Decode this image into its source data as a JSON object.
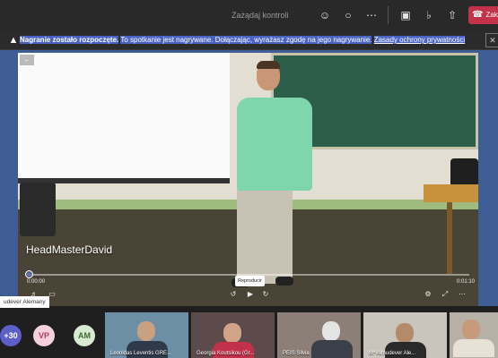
{
  "topbar": {
    "request_control": "Zażądaj kontroli",
    "icons": [
      "people-icon",
      "react-icon",
      "more-icon",
      "camera-icon",
      "microphone-icon",
      "share-tray-icon"
    ],
    "leave_label": "Zak"
  },
  "banner": {
    "bold": "Nagranie zostało rozpoczęte.",
    "text": "To spotkanie jest nagrywane. Dołączając, wyrażasz zgodę na jego nagrywanie.",
    "link": "Zasady ochrony prywatności"
  },
  "video": {
    "presenter_name": "HeadMasterDavid",
    "time_elapsed": "0:00:00",
    "time_total": "0:01:10",
    "progress": 0.0,
    "tooltip": "Reproducir"
  },
  "name_chip": "udever Alemany",
  "strip": {
    "avatars": [
      {
        "label": "+30",
        "color": "#5b5fc7"
      },
      {
        "label": "VP",
        "color": "#f6d1dc",
        "text_color": "#b23a6b"
      },
      {
        "label": "AM",
        "color": "#d9ead3",
        "text_color": "#3d6b2e"
      }
    ],
    "tiles": [
      {
        "name": "Leonidas Leventis GRE...",
        "bg": "#6d8fa6"
      },
      {
        "name": "Georgia Koutsikou (Gr...",
        "bg": "#5d4a4a"
      },
      {
        "name": "PEIS Silvia",
        "bg": "#8c7f77"
      },
      {
        "name": "Mª Almudever Ale...",
        "bg": "#c9c4bc"
      },
      {
        "name": "",
        "bg": "#b7b0a6"
      }
    ]
  }
}
